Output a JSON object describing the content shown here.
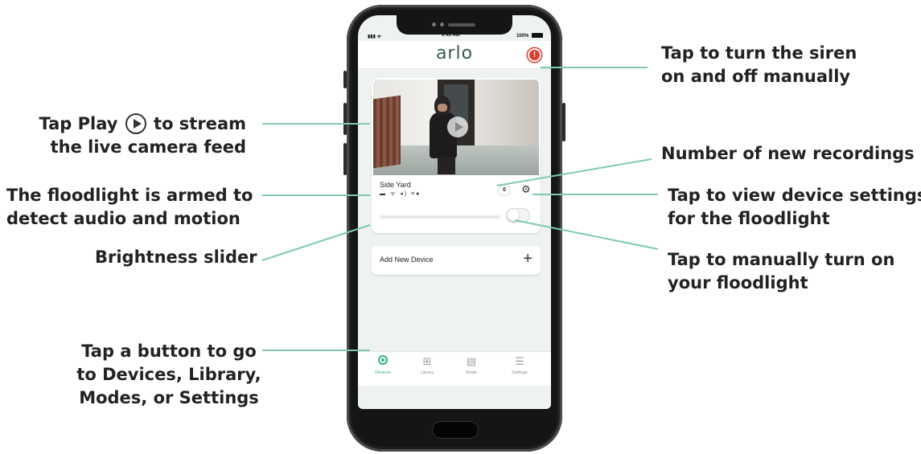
{
  "callouts": {
    "play": {
      "before": "Tap Play",
      "after": "to stream",
      "line2": "the live camera feed"
    },
    "armed": {
      "line1": "The floodlight is armed to",
      "line2": "detect audio and motion"
    },
    "brightness": {
      "line1": "Brightness slider"
    },
    "tabs": {
      "line1": "Tap a button to go",
      "line2": "to Devices, Library,",
      "line3": "Modes, or Settings"
    },
    "siren": {
      "line1": "Tap to turn the siren",
      "line2": "on and off manually"
    },
    "recordings": {
      "line1": "Number of new recordings"
    },
    "settings": {
      "line1": "Tap to view device settings",
      "line2": "for the floodlight"
    },
    "toggle": {
      "line1": "Tap to manually turn on",
      "line2": "your floodlight"
    }
  },
  "status_bar": {
    "time": "9:41 AM",
    "battery": "100%"
  },
  "app": {
    "logo": "arlo",
    "siren_glyph": "!"
  },
  "device": {
    "name": "Side Yard",
    "new_recordings": "0",
    "status_icons": "▬ ᯤ ◂) ≡●"
  },
  "add_device": {
    "label": "Add New Device",
    "plus": "+"
  },
  "tabs": [
    {
      "label": "Devices",
      "icon": "devices-icon",
      "active": true
    },
    {
      "label": "Library",
      "icon": "library-icon",
      "glyph": "▫▫"
    },
    {
      "label": "Mode",
      "icon": "mode-icon",
      "glyph": "☰"
    },
    {
      "label": "Settings",
      "icon": "settings-icon",
      "glyph": "≡"
    }
  ],
  "colors": {
    "accent": "#2db08a",
    "leader_line": "#7fcaae",
    "siren": "#e33b2e"
  }
}
